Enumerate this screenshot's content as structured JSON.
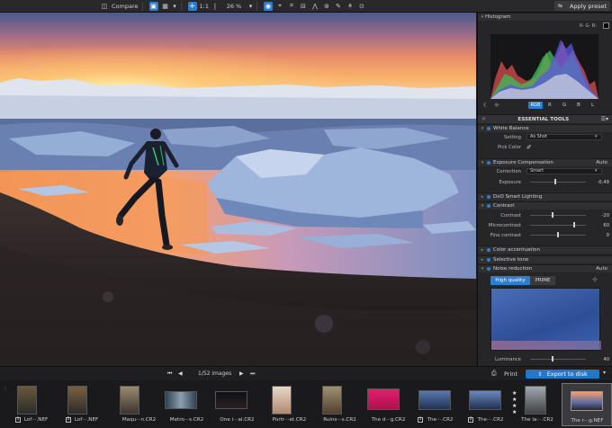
{
  "toolbar": {
    "compare_label": "Compare",
    "ratio_label": "1:1",
    "zoom_value": "26 %",
    "apply_preset_label": "Apply preset"
  },
  "histogram": {
    "title": "Histogram",
    "channels_label": "R- G- B-",
    "channel_buttons": [
      "RGB",
      "R",
      "G",
      "B",
      "L"
    ]
  },
  "essential_tools": {
    "title": "ESSENTIAL TOOLS",
    "white_balance": {
      "title": "White Balance",
      "setting_label": "Setting",
      "setting_value": "As Shot",
      "pick_color_label": "Pick Color"
    },
    "exposure": {
      "title": "Exposure Compensation",
      "mode": "Auto",
      "correction_label": "Correction",
      "correction_value": "Smart",
      "exposure_label": "Exposure",
      "exposure_value": "-0,49",
      "exposure_level": 0.45
    },
    "smart_lighting": {
      "title": "DxO Smart Lighting"
    },
    "contrast": {
      "title": "Contrast",
      "rows": [
        {
          "label": "Contrast",
          "value": "-20",
          "level": 0.4
        },
        {
          "label": "Microcontrast",
          "value": "60",
          "level": 0.8
        },
        {
          "label": "Fine contrast",
          "value": "0",
          "level": 0.5
        }
      ]
    },
    "color_accentuation": {
      "title": "Color accentuation"
    },
    "selective_tone": {
      "title": "Selective tone"
    },
    "noise_reduction": {
      "title": "Noise reduction",
      "mode": "Auto",
      "tabs": [
        "High quality",
        "PRIME"
      ],
      "luminance_label": "Luminance",
      "luminance_value": "40",
      "luminance_level": 0.4
    }
  },
  "stripnav": {
    "count_label": "1/52 images",
    "print_label": "Print",
    "export_label": "Export to disk"
  },
  "filmstrip": [
    {
      "label": "Lof···.NEF",
      "version": "1"
    },
    {
      "label": "Lof···.NEF",
      "version": "2"
    },
    {
      "label": "Maqu···n.CR2",
      "version": ""
    },
    {
      "label": "Metro···s.CR2",
      "version": ""
    },
    {
      "label": "One i···al.CR2",
      "version": ""
    },
    {
      "label": "Portr···et.CR2",
      "version": ""
    },
    {
      "label": "Ruins···s.CR2",
      "version": ""
    },
    {
      "label": "The d···g.CR2",
      "version": ""
    },
    {
      "label": "The···.CR2",
      "version": "1"
    },
    {
      "label": "The···.CR2",
      "version": "2"
    },
    {
      "label": "The la···.CR2",
      "version": ""
    },
    {
      "label": "The r···g.NEF",
      "version": ""
    }
  ],
  "colors": {
    "accent": "#2c7fd0",
    "export": "#2476c7",
    "panel_bg": "#262628",
    "toolbar_bg": "#29292b"
  }
}
